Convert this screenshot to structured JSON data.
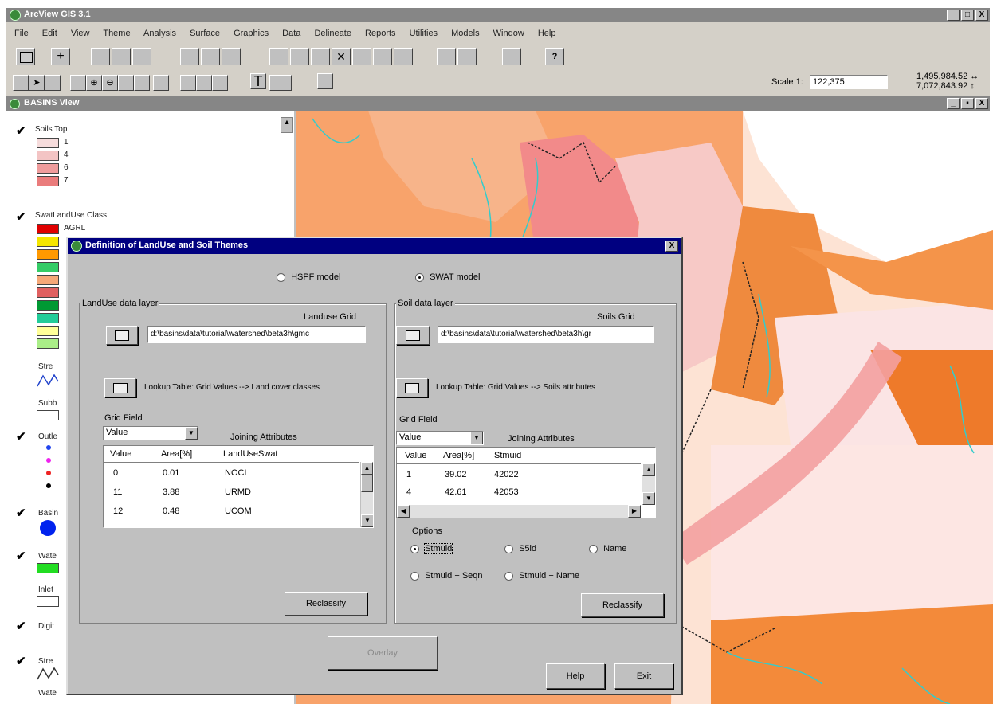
{
  "app": {
    "title": "ArcView GIS 3.1",
    "window_buttons": [
      "_",
      "□",
      "X"
    ]
  },
  "menu": [
    "File",
    "Edit",
    "View",
    "Theme",
    "Analysis",
    "Surface",
    "Graphics",
    "Data",
    "Delineate",
    "Reports",
    "Utilities",
    "Models",
    "Window",
    "Help"
  ],
  "toolbar": {
    "scale_label": "Scale 1:",
    "scale_value": "122,375",
    "coords_line1": "1,495,984.52 ↔",
    "coords_line2": "7,072,843.92 ↕"
  },
  "view_window": {
    "title": "BASINS View",
    "window_buttons": [
      "_",
      "▪",
      "X"
    ]
  },
  "legend": {
    "soils": {
      "title": "Soils Top",
      "items": [
        "1",
        "4",
        "6",
        "7"
      ],
      "colors": [
        "#f6dcdc",
        "#f3c4c4",
        "#ef9c9c",
        "#ea7c7c"
      ]
    },
    "landuse": {
      "title": "SwatLandUse Class",
      "first_item": "AGRL",
      "colors": [
        "#e00000",
        "#f5e600",
        "#ff9900",
        "#33cc66",
        "#f5a878",
        "#e06060",
        "#009933",
        "#22cc99",
        "#ffff99",
        "#aaee88"
      ]
    },
    "other_items": [
      "Stre",
      "Subb",
      "Outle",
      "Basin",
      "Wate",
      "Inlet",
      "Digit",
      "Stre",
      "Wate"
    ]
  },
  "dialog": {
    "title": "Definition of LandUse and Soil Themes",
    "close": "X",
    "model_hspf": "HSPF model",
    "model_swat": "SWAT model",
    "landuse": {
      "group_label": "LandUse data layer",
      "grid_label": "Landuse Grid",
      "grid_path": "d:\\basins\\data\\tutorial\\watershed\\beta3h\\gmc",
      "lookup_label": "Lookup Table: Grid Values --> Land cover classes",
      "grid_field_label": "Grid Field",
      "grid_field_value": "Value",
      "joining_label": "Joining Attributes",
      "columns": [
        "Value",
        "Area[%]",
        "LandUseSwat"
      ],
      "rows": [
        [
          "0",
          "0.01",
          "NOCL"
        ],
        [
          "11",
          "3.88",
          "URMD"
        ],
        [
          "12",
          "0.48",
          "UCOM"
        ]
      ],
      "reclassify": "Reclassify"
    },
    "soil": {
      "group_label": "Soil data layer",
      "grid_label": "Soils Grid",
      "grid_path": "d:\\basins\\data\\tutorial\\watershed\\beta3h\\gr",
      "lookup_label": "Lookup Table: Grid Values --> Soils attributes",
      "grid_field_label": "Grid Field",
      "grid_field_value": "Value",
      "joining_label": "Joining Attributes",
      "columns": [
        "Value",
        "Area[%]",
        "Stmuid"
      ],
      "rows": [
        [
          "1",
          "39.02",
          "42022"
        ],
        [
          "4",
          "42.61",
          "42053"
        ]
      ],
      "options_label": "Options",
      "opt_stmuid": "Stmuid",
      "opt_s5id": "S5id",
      "opt_name": "Name",
      "opt_stmuid_seqn": "Stmuid + Seqn",
      "opt_stmuid_name": "Stmuid + Name",
      "reclassify": "Reclassify"
    },
    "overlay_button": "Overlay",
    "help_button": "Help",
    "exit_button": "Exit"
  }
}
